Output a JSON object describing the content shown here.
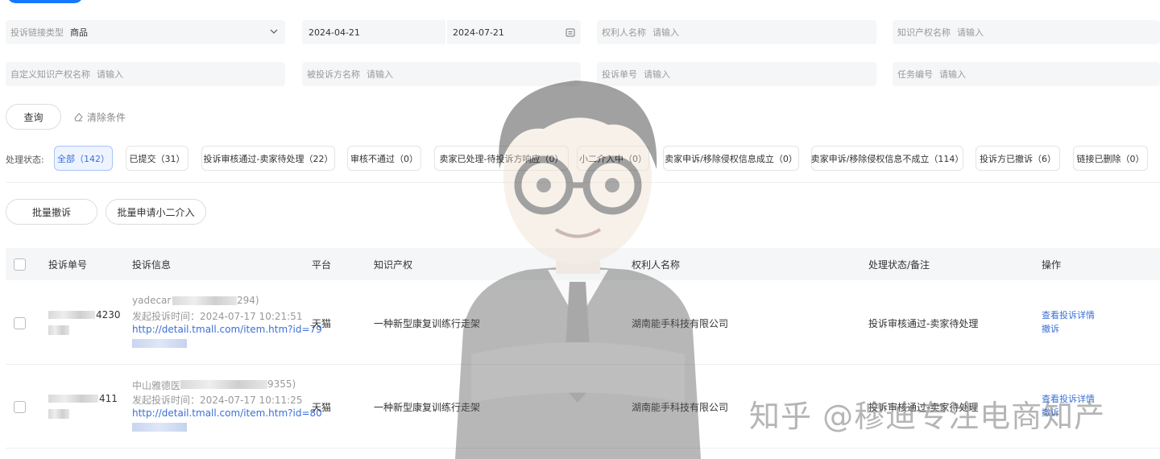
{
  "filters": {
    "complaint_link_type": {
      "label": "投诉链接类型",
      "value": "商品"
    },
    "date_start": "2024-04-21",
    "date_end": "2024-07-21",
    "rights_holder": {
      "label": "权利人名称",
      "placeholder": "请输入"
    },
    "ip_name": {
      "label": "知识产权名称",
      "placeholder": "请输入"
    },
    "custom_ip_name": {
      "label": "自定义知识产权名称",
      "placeholder": "请输入"
    },
    "respondent": {
      "label": "被投诉方名称",
      "placeholder": "请输入"
    },
    "complaint_no": {
      "label": "投诉单号",
      "placeholder": "请输入"
    },
    "task_no": {
      "label": "任务编号",
      "placeholder": "请输入"
    }
  },
  "actions": {
    "query": "查询",
    "clear": "清除条件"
  },
  "status": {
    "label": "处理状态:",
    "chips": [
      "全部（142）",
      "已提交（31）",
      "投诉审核通过-卖家待处理（22）",
      "审核不通过（0）",
      "卖家已处理-待投诉方响应（0）",
      "小二介入中（0）",
      "卖家申诉/移除侵权信息成立（0）",
      "卖家申诉/移除侵权信息不成立（114）",
      "投诉方已撤诉（6）",
      "链接已删除（0）"
    ]
  },
  "bulk": {
    "withdraw": "批量撤诉",
    "intervene": "批量申请小二介入"
  },
  "table": {
    "headers": [
      "投诉单号",
      "投诉信息",
      "平台",
      "知识产权",
      "权利人名称",
      "处理状态/备注",
      "操作"
    ],
    "rows": [
      {
        "id_suffix": "4230",
        "info_name": "yadecar",
        "info_name_suffix": "294)",
        "info_time": "发起投诉时间：2024-07-17 10:21:51",
        "info_link": "http://detail.tmall.com/item.htm?id=79",
        "platform": "天猫",
        "ip": "一种新型康复训练行走架",
        "holder": "湖南能手科技有限公司",
        "status": "投诉审核通过-卖家待处理",
        "op_detail": "查看投诉详情",
        "op_withdraw": "撤诉"
      },
      {
        "id_suffix": "411",
        "info_name": "中山雅德医",
        "info_name_suffix": "9355)",
        "info_time": "发起投诉时间：2024-07-17 10:11:25",
        "info_link": "http://detail.tmall.com/item.htm?id=80",
        "platform": "天猫",
        "ip": "一种新型康复训练行走架",
        "holder": "湖南能手科技有限公司",
        "status": "投诉审核通过-卖家待处理",
        "op_detail": "查看投诉详情",
        "op_withdraw": "撤诉"
      }
    ]
  },
  "watermark": "知乎 @穆迪专注电商知产",
  "colors": {
    "accent": "#3a6fd8",
    "chip_active_bg": "#eef4ff",
    "field_bg": "#f5f6f7"
  }
}
